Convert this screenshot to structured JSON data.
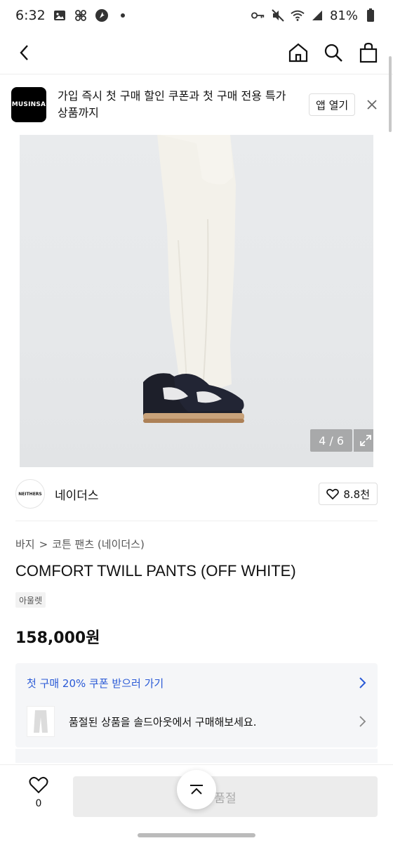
{
  "status_bar": {
    "time": "6:32",
    "battery": "81%"
  },
  "top_nav": {
    "back_icon": "chevron-left-icon",
    "home_icon": "home-icon",
    "search_icon": "search-icon",
    "cart_icon": "shopping-bag-icon"
  },
  "app_banner": {
    "logo_text": "MUSINSA",
    "message": "가입 즉시 첫 구매 할인 쿠폰과 첫 구매 전용 특가 상품까지",
    "open_app_label": "앱 열기"
  },
  "gallery": {
    "page_indicator": "4 / 6"
  },
  "brand": {
    "logo_text": "NEITHERS",
    "name": "네이더스",
    "likes": "8.8천"
  },
  "breadcrumb": {
    "category": "바지",
    "separator": ">",
    "subcategory": "코튼 팬츠 (네이더스)"
  },
  "product": {
    "title": "COMFORT TWILL PANTS (OFF WHITE)",
    "tag": "아울렛",
    "price": "158,000원"
  },
  "promo": {
    "coupon_text": "첫 구매 20% 쿠폰 받으러 가기",
    "soldout_text": "품절된 상품을 솔드아웃에서 구매해보세요."
  },
  "bottom_bar": {
    "wish_count": "0",
    "soldout_label": "품절"
  },
  "colors": {
    "accent_blue": "#2a5ad6",
    "brand_black": "#000000"
  }
}
